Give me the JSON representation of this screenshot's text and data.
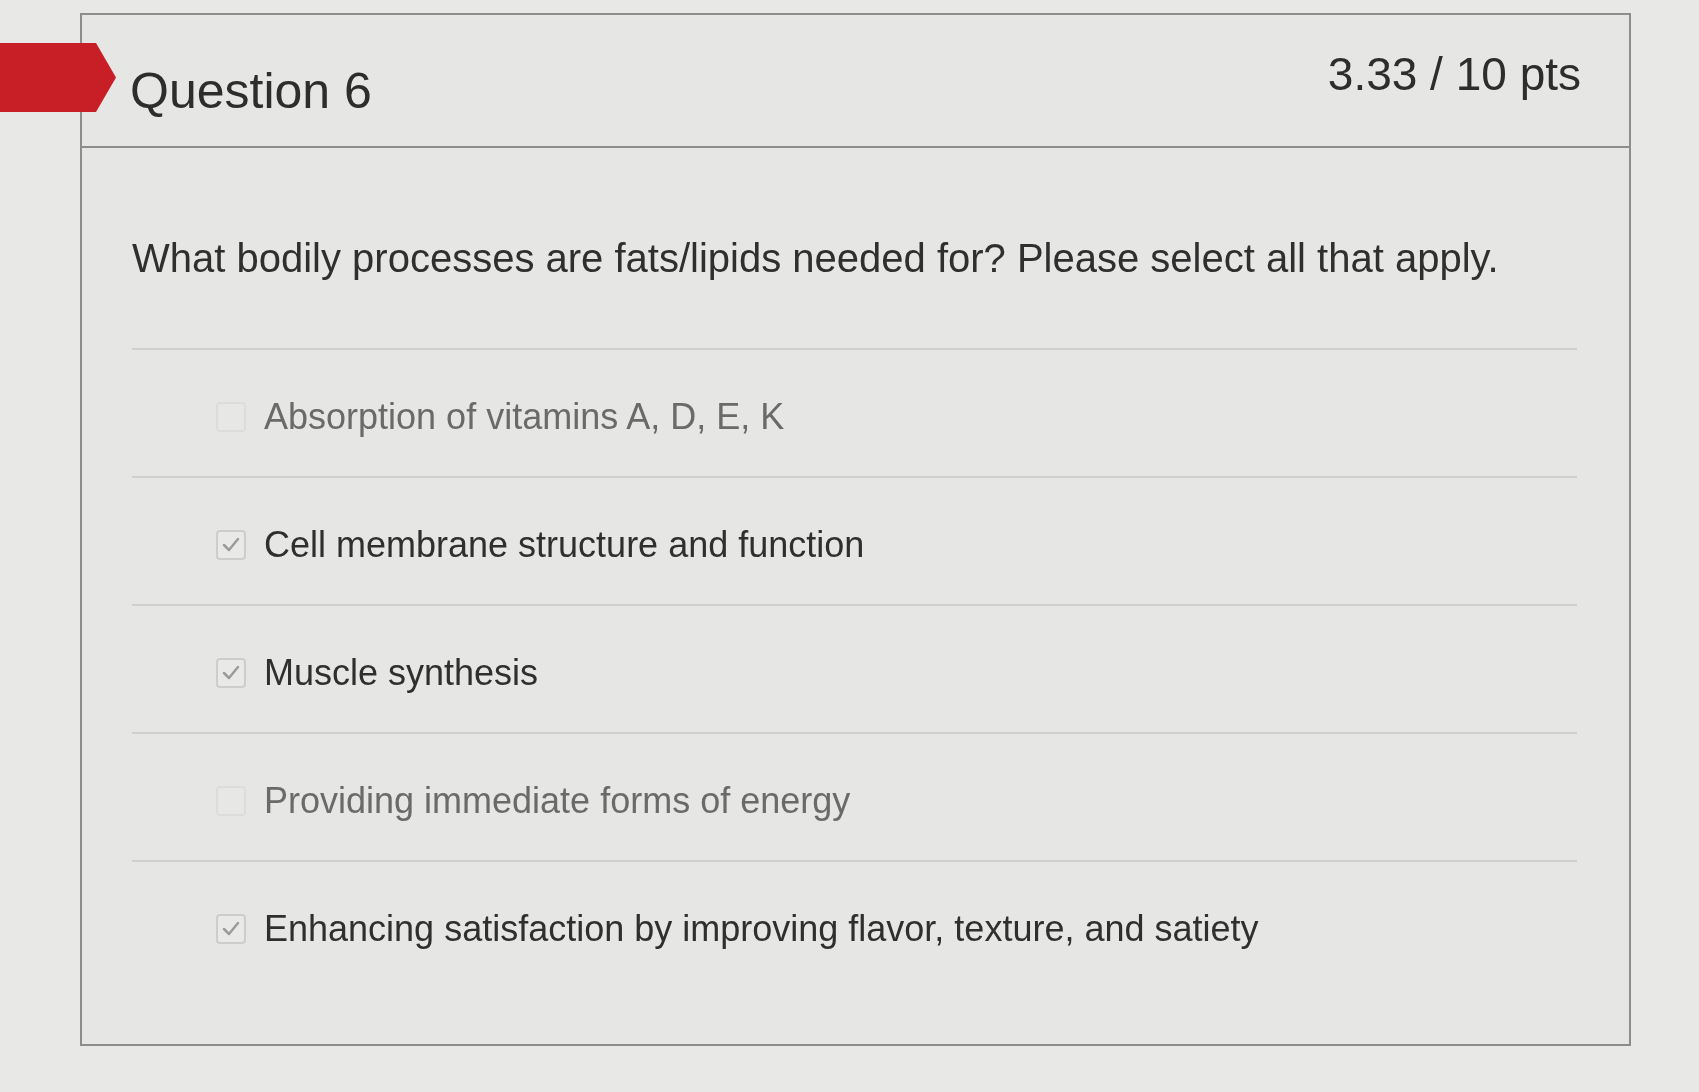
{
  "question": {
    "title": "Question 6",
    "score": "3.33 / 10 pts",
    "flagged": true,
    "prompt": "What bodily processes are fats/lipids needed for? Please select all that apply.",
    "options": [
      {
        "label": "Absorption of vitamins A, D, E, K",
        "checked": false
      },
      {
        "label": "Cell membrane structure and function",
        "checked": true
      },
      {
        "label": "Muscle synthesis",
        "checked": true
      },
      {
        "label": "Providing immediate forms of energy",
        "checked": false
      },
      {
        "label": "Enhancing satisfaction by improving flavor, texture, and satiety",
        "checked": true
      }
    ]
  }
}
